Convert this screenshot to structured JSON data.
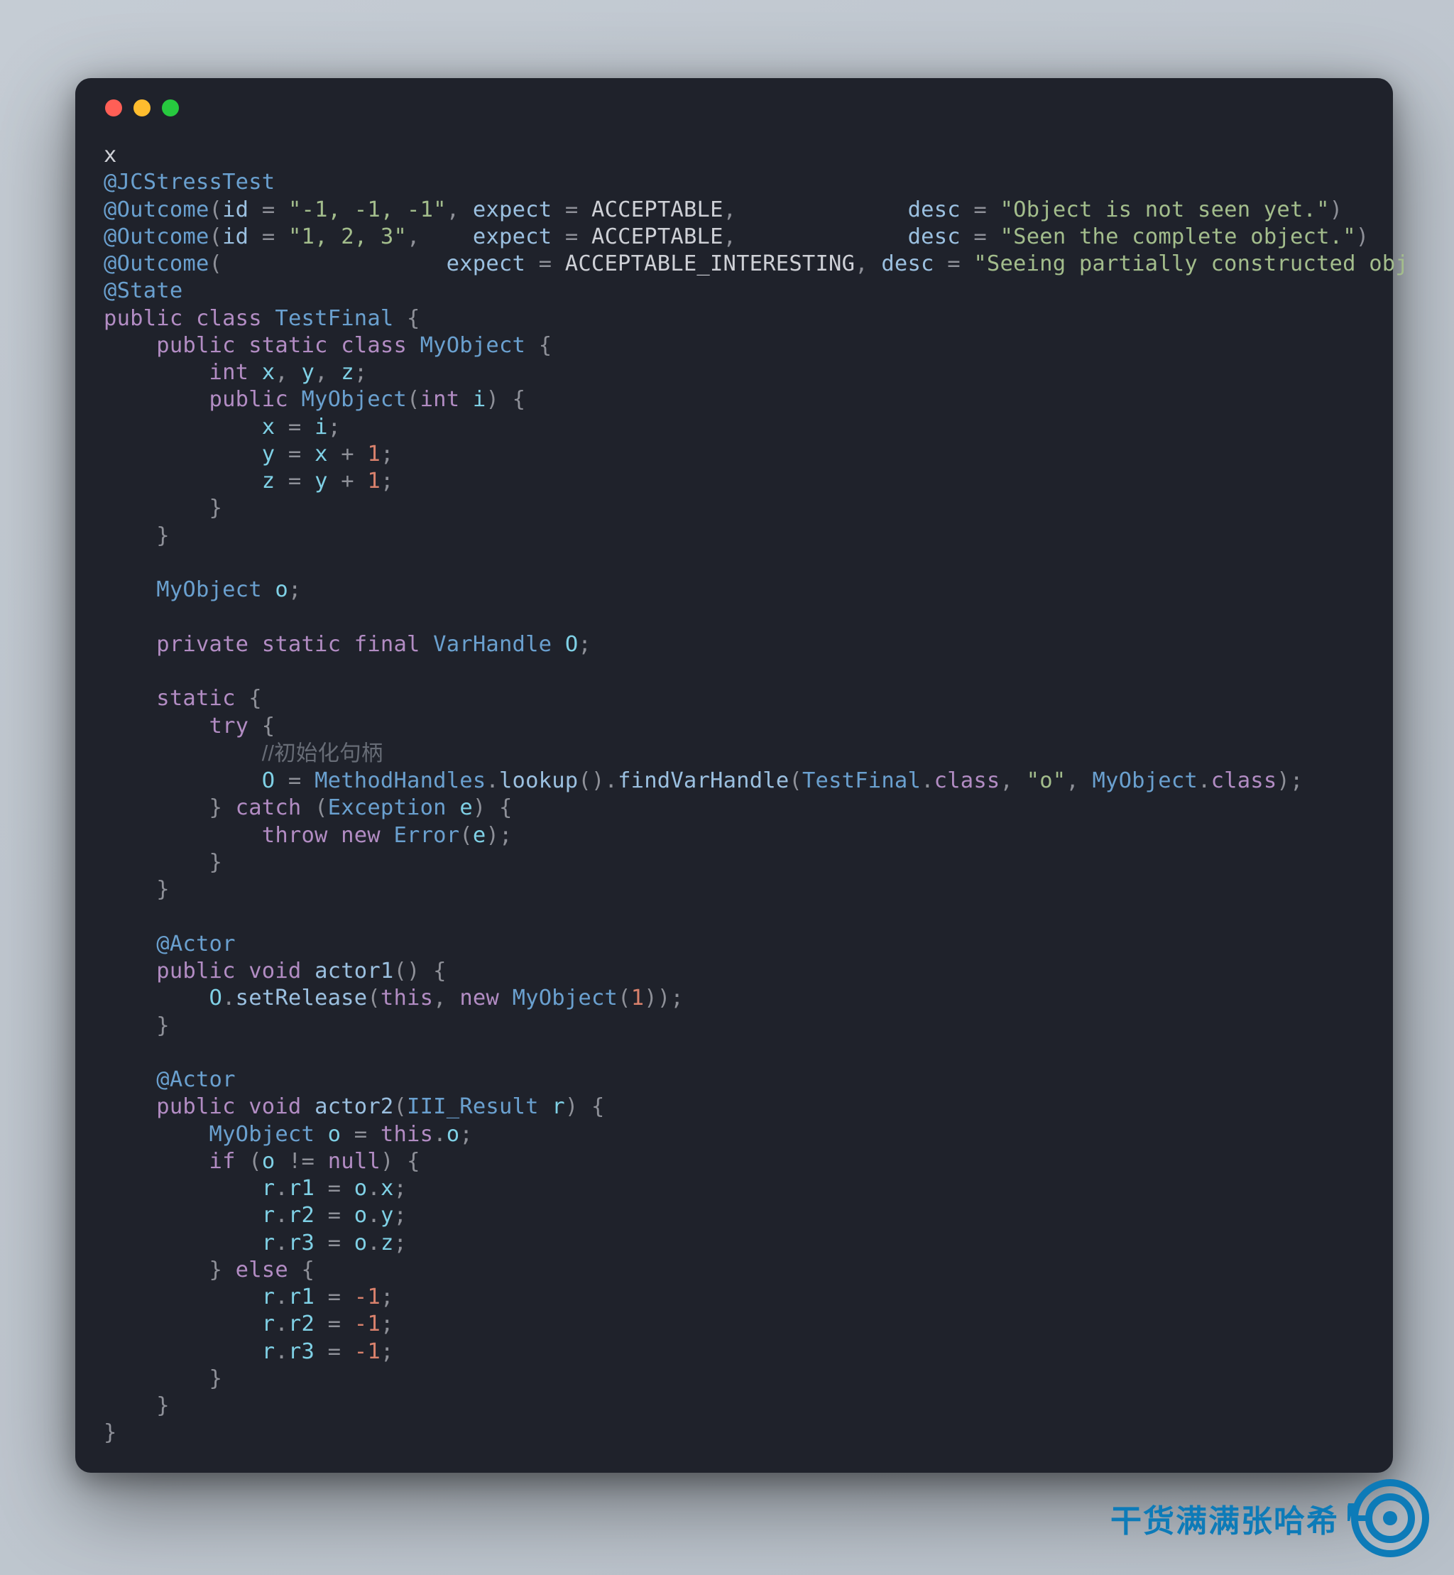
{
  "watermark": {
    "text": "干货满满张哈希"
  },
  "code": {
    "line_x": "x",
    "ann_jcstress": "@JCStressTest",
    "ann_outcome": "@Outcome",
    "ann_state": "@State",
    "ann_actor": "@Actor",
    "attr_id": "id",
    "attr_expect": "expect",
    "attr_desc": "desc",
    "str_id1": "\"-1, -1, -1\"",
    "str_id2": "\"1, 2, 3\"",
    "acc": "ACCEPTABLE",
    "acc_int": "ACCEPTABLE_INTERESTING",
    "desc1": "\"Object is not seen yet.\"",
    "desc2": "\"Seen the complete object.\"",
    "desc3": "\"Seeing partially constructed obj",
    "kw_public": "public",
    "kw_class": "class",
    "kw_static": "static",
    "kw_int": "int",
    "kw_void": "void",
    "kw_private": "private",
    "kw_final": "final",
    "kw_try": "try",
    "kw_catch": "catch",
    "kw_throw": "throw",
    "kw_new": "new",
    "kw_if": "if",
    "kw_else": "else",
    "kw_this": "this",
    "kw_null": "null",
    "cls_TestFinal": "TestFinal",
    "cls_MyObject": "MyObject",
    "cls_VarHandle": "VarHandle",
    "cls_MethodHandles": "MethodHandles",
    "cls_Exception": "Exception",
    "cls_Error": "Error",
    "cls_III_Result": "III_Result",
    "var_x": "x",
    "var_y": "y",
    "var_z": "z",
    "var_i": "i",
    "var_o": "o",
    "var_O": "O",
    "var_e": "e",
    "var_r": "r",
    "m_lookup": "lookup",
    "m_findVarHandle": "findVarHandle",
    "m_setRelease": "setRelease",
    "m_actor1": "actor1",
    "m_actor2": "actor2",
    "fld_r1": "r1",
    "fld_r2": "r2",
    "fld_r3": "r3",
    "fld_class": "class",
    "str_o": "\"o\"",
    "num_1": "1",
    "num_neg1": "-1",
    "comment_init": "//初始化句柄"
  }
}
